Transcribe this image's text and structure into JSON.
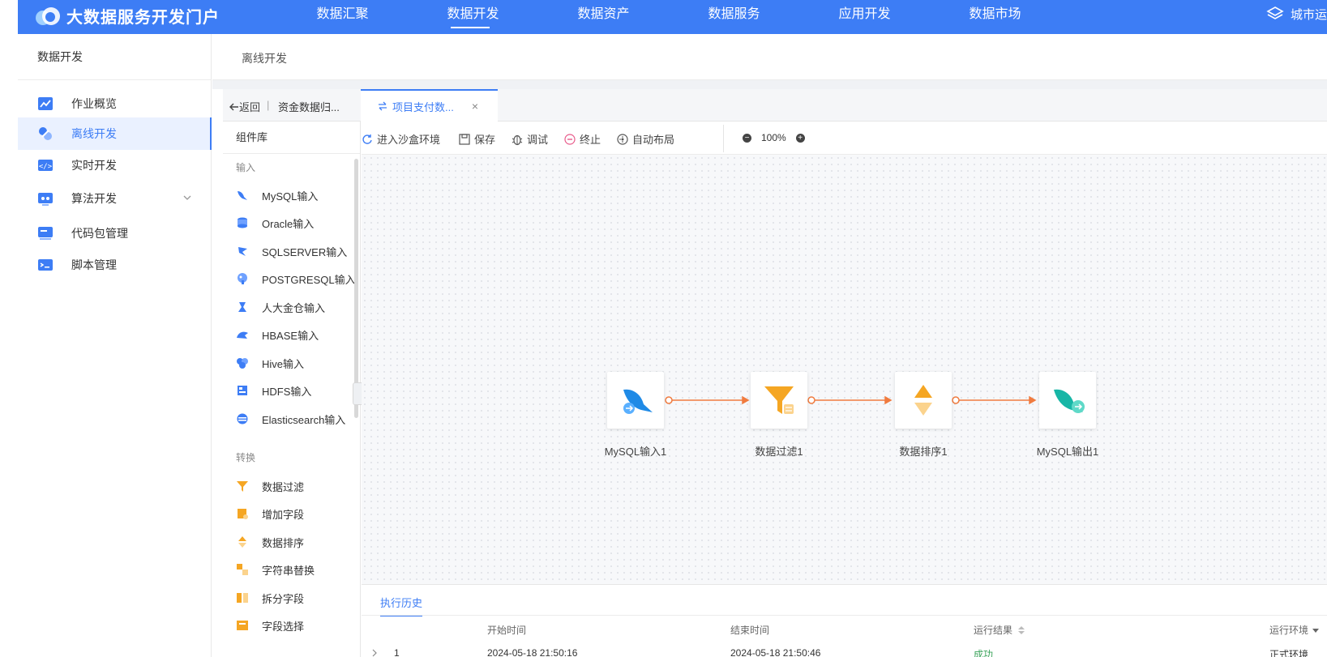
{
  "header": {
    "app_title": "大数据服务开发门户",
    "nav": [
      "数据汇聚",
      "数据开发",
      "数据资产",
      "数据服务",
      "应用开发",
      "数据市场"
    ],
    "active_nav": 1,
    "right_text": "城市运"
  },
  "sidebar": {
    "title": "数据开发",
    "items": [
      {
        "label": "作业概览",
        "icon": "chart-icon"
      },
      {
        "label": "离线开发",
        "icon": "link-icon"
      },
      {
        "label": "实时开发",
        "icon": "code-icon"
      },
      {
        "label": "算法开发",
        "icon": "algorithm-icon"
      },
      {
        "label": "代码包管理",
        "icon": "package-icon"
      },
      {
        "label": "脚本管理",
        "icon": "terminal-icon"
      }
    ]
  },
  "page": {
    "title": "离线开发"
  },
  "tabs": {
    "back_label": "返回",
    "separator": "|",
    "tab1_label": "资金数据归...",
    "tab2_label": "项目支付数...",
    "close": "×"
  },
  "library": {
    "title": "组件库",
    "input_section": "输入",
    "inputs": [
      "MySQL输入",
      "Oracle输入",
      "SQLSERVER输入",
      "POSTGRESQL输入",
      "人大金仓输入",
      "HBASE输入",
      "Hive输入",
      "HDFS输入",
      "Elasticsearch输入"
    ],
    "transform_section": "转换",
    "transforms": [
      "数据过滤",
      "增加字段",
      "数据排序",
      "字符串替换",
      "拆分字段",
      "字段选择"
    ]
  },
  "toolbar": {
    "sandbox": "进入沙盒环境",
    "save": "保存",
    "debug": "调试",
    "stop": "终止",
    "auto_layout": "自动布局",
    "zoom": "100%"
  },
  "canvas": {
    "nodes": [
      "MySQL输入1",
      "数据过滤1",
      "数据排序1",
      "MySQL输出1"
    ]
  },
  "history": {
    "tab": "执行历史",
    "columns": [
      "开始时间",
      "结束时间",
      "运行结果",
      "运行环境"
    ],
    "rows": [
      {
        "index": "1",
        "start": "2024-05-18 21:50:16",
        "end": "2024-05-18 21:50:46",
        "result": "成功",
        "env": "正式环境"
      }
    ]
  },
  "colors": {
    "brand": "#3d7df5",
    "edge": "#f07b3f",
    "success": "#3aa35a"
  }
}
